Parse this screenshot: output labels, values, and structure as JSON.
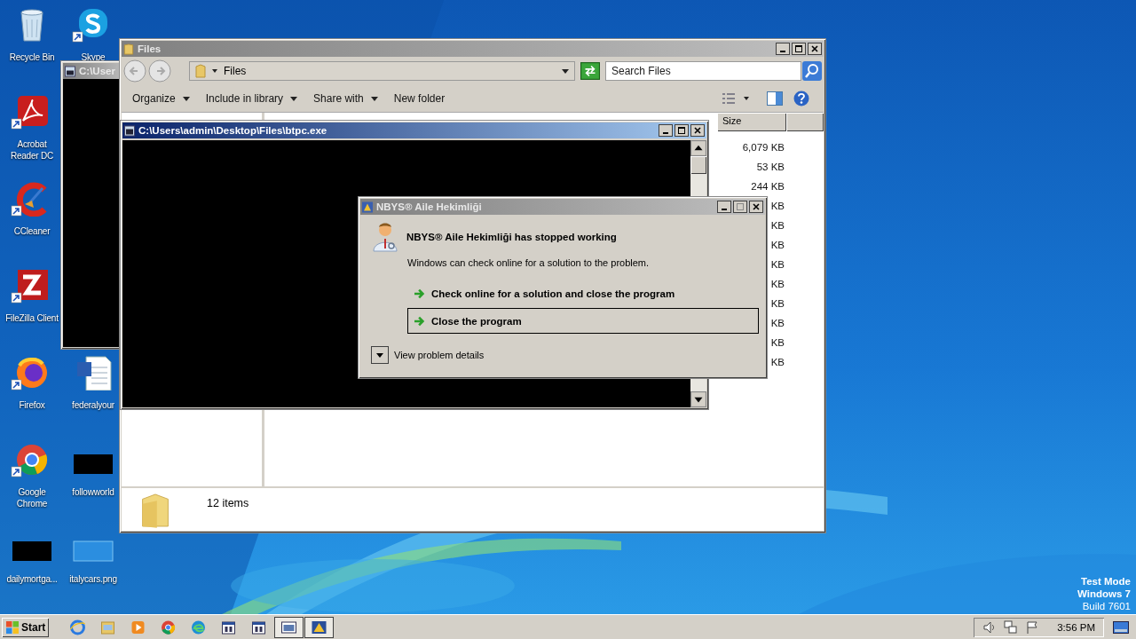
{
  "desktop": {
    "icon_rows": [
      [
        {
          "label": "Recycle Bin",
          "kind": "recycle-bin"
        },
        {
          "label": "Skype",
          "kind": "skype"
        }
      ],
      [
        {
          "label": "Acrobat Reader DC",
          "kind": "acrobat"
        }
      ],
      [
        {
          "label": "CCleaner",
          "kind": "ccleaner"
        }
      ],
      [
        {
          "label": "FileZilla Client",
          "kind": "filezilla"
        }
      ],
      [
        {
          "label": "Firefox",
          "kind": "firefox"
        },
        {
          "label": "federalyour",
          "kind": "word-document"
        }
      ],
      [
        {
          "label": "Google Chrome",
          "kind": "chrome"
        },
        {
          "label": "followworld",
          "kind": "dark-thumbnail"
        }
      ],
      [
        {
          "label": "dailymortga...",
          "kind": "dark-thumbnail"
        },
        {
          "label": "italycars.png",
          "kind": "image-thumbnail"
        }
      ]
    ],
    "os_notice": [
      "Test Mode",
      "Windows 7",
      "Build 7601"
    ]
  },
  "back_console": {
    "title": "C:\\User"
  },
  "explorer": {
    "title": "Files",
    "address": "Files",
    "search": {
      "placeholder": "Search Files"
    },
    "commands": [
      {
        "label": "Organize",
        "menu": true
      },
      {
        "label": "Include in library",
        "menu": true
      },
      {
        "label": "Share with",
        "menu": true
      },
      {
        "label": "New folder",
        "menu": false
      }
    ],
    "columns": [
      "Size"
    ],
    "rows": [
      {
        "size": "6,079 KB"
      },
      {
        "size": "53 KB"
      },
      {
        "size": "244 KB"
      },
      {
        "size": "KB"
      },
      {
        "size": "KB"
      },
      {
        "size": "KB"
      },
      {
        "size": "KB"
      },
      {
        "size": "KB"
      },
      {
        "size": "KB"
      },
      {
        "size": "KB"
      },
      {
        "size": "KB"
      },
      {
        "size": "KB"
      }
    ],
    "status": "12 items"
  },
  "console": {
    "title": "C:\\Users\\admin\\Desktop\\Files\\btpc.exe"
  },
  "error_dialog": {
    "title": "NBYS® Aile Hekimliği",
    "heading": "NBYS® Aile Hekimliği has stopped working",
    "message": "Windows can check online for a solution to the problem.",
    "options": [
      {
        "label": "Check online for a solution and close the program",
        "selected": false
      },
      {
        "label": "Close the program",
        "selected": true
      }
    ],
    "details": "View problem details"
  },
  "taskbar": {
    "start": "Start",
    "buttons": [
      {
        "kind": "internet-explorer",
        "selected": false
      },
      {
        "kind": "folder",
        "selected": false
      },
      {
        "kind": "media-player",
        "selected": false
      },
      {
        "kind": "chrome",
        "selected": false
      },
      {
        "kind": "edge",
        "selected": false
      },
      {
        "kind": "app-window",
        "selected": false
      },
      {
        "kind": "app-window",
        "selected": false
      },
      {
        "kind": "console",
        "selected": true
      },
      {
        "kind": "app-dialog",
        "selected": true
      }
    ],
    "clock": "3:56 PM"
  }
}
